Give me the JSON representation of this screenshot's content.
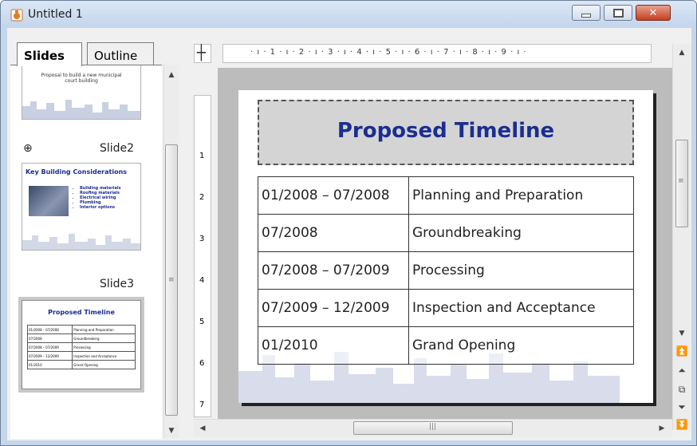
{
  "window": {
    "title": "Untitled 1",
    "icon": "impress-app-icon",
    "controls": {
      "minimize": "minimize-icon",
      "maximize": "maximize-icon",
      "close": "close-icon"
    }
  },
  "left_pane": {
    "tabs": [
      {
        "label": "Slides",
        "active": true
      },
      {
        "label": "Outline",
        "active": false
      }
    ],
    "slides": [
      {
        "label": "",
        "thumb_text": "Proposal to build a new municipal court building"
      },
      {
        "label": "Slide2",
        "thumb_title": "Key Building Considerations",
        "bullets": [
          "Building materials",
          "Roofing materials",
          "Electrical wiring",
          "Plumbing",
          "Interior options"
        ]
      },
      {
        "label": "Slide3",
        "thumb_title": "Proposed Timeline"
      }
    ]
  },
  "ruler": {
    "h_marks": [
      "1",
      "2",
      "3",
      "4",
      "5",
      "6",
      "7",
      "8",
      "9"
    ],
    "v_marks": [
      "1",
      "2",
      "3",
      "4",
      "5",
      "6",
      "7"
    ]
  },
  "slide": {
    "title": "Proposed Timeline",
    "rows": [
      {
        "date": "01/2008 – 07/2008",
        "task": "Planning and Preparation"
      },
      {
        "date": "07/2008",
        "task": "Groundbreaking"
      },
      {
        "date": "07/2008 – 07/2009",
        "task": "Processing"
      },
      {
        "date": "07/2009 – 12/2009",
        "task": "Inspection and Acceptance"
      },
      {
        "date": "01/2010",
        "task": "Grand Opening"
      }
    ]
  },
  "colors": {
    "title_blue": "#1c2d8f",
    "titlebar": "#c2d5ec",
    "close_red": "#c4401f"
  }
}
